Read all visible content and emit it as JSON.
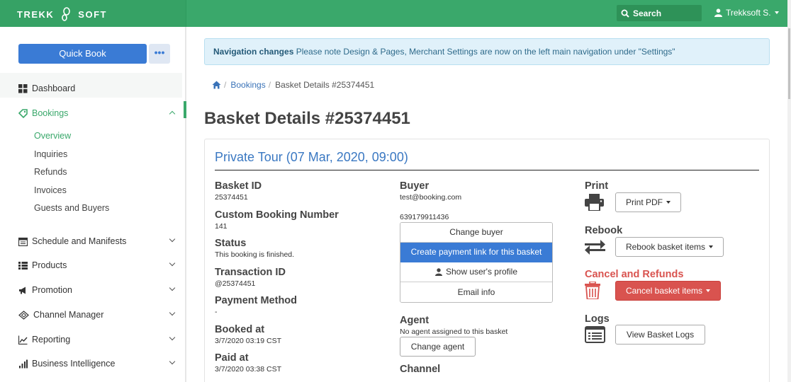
{
  "header": {
    "logo_left": "TREKK",
    "logo_right": "SOFT",
    "search_label": "Search",
    "user_name": "Trekksoft S."
  },
  "sidebar": {
    "quick_book": "Quick Book",
    "more": "•••",
    "items": [
      {
        "label": "Dashboard",
        "icon": "dashboard-icon"
      },
      {
        "label": "Bookings",
        "icon": "tag-icon",
        "expanded": true
      },
      {
        "label": "Schedule and Manifests",
        "icon": "calendar-icon"
      },
      {
        "label": "Products",
        "icon": "list-icon"
      },
      {
        "label": "Promotion",
        "icon": "megaphone-icon"
      },
      {
        "label": "Channel Manager",
        "icon": "network-icon"
      },
      {
        "label": "Reporting",
        "icon": "line-chart-icon"
      },
      {
        "label": "Business Intelligence",
        "icon": "bar-chart-icon"
      }
    ],
    "sub_items": [
      "Overview",
      "Inquiries",
      "Refunds",
      "Invoices",
      "Guests and Buyers"
    ]
  },
  "alert": {
    "title": "Navigation changes",
    "message": " Please note Design & Pages, Merchant Settings are now on the left main navigation under \"Settings\""
  },
  "breadcrumb": {
    "items": [
      "Bookings",
      "Basket Details #25374451"
    ]
  },
  "page": {
    "title": "Basket Details #25374451"
  },
  "basket": {
    "title": "Private Tour (07 Mar, 2020, 09:00)",
    "fields": [
      {
        "label": "Basket ID",
        "value": "25374451"
      },
      {
        "label": "Custom Booking Number",
        "value": "141"
      },
      {
        "label": "Status",
        "value": "This booking is finished."
      },
      {
        "label": "Transaction ID",
        "value": "@25374451"
      },
      {
        "label": "Payment Method",
        "value": "-"
      },
      {
        "label": "Booked at",
        "value": "3/7/2020 03:19 CST"
      },
      {
        "label": "Paid at",
        "value": "3/7/2020 03:38 CST"
      }
    ]
  },
  "buyer": {
    "label": "Buyer",
    "email": "test@booking.com",
    "phone": "639179911436",
    "actions": [
      "Change buyer",
      "Create payment link for this basket",
      "Show user's profile",
      "Email info"
    ]
  },
  "agent": {
    "label": "Agent",
    "value": "No agent assigned to this basket",
    "button": "Change agent"
  },
  "channel": {
    "label": "Channel"
  },
  "actions": {
    "print_label": "Print",
    "print_button": "Print PDF",
    "rebook_label": "Rebook",
    "rebook_button": "Rebook basket items",
    "cancel_label": "Cancel and Refunds",
    "cancel_button": "Cancel basket items",
    "logs_label": "Logs",
    "logs_button": "View Basket Logs"
  },
  "colors": {
    "brand_green": "#3aa86b",
    "primary_blue": "#3a7bd5",
    "danger_red": "#d9534f"
  }
}
